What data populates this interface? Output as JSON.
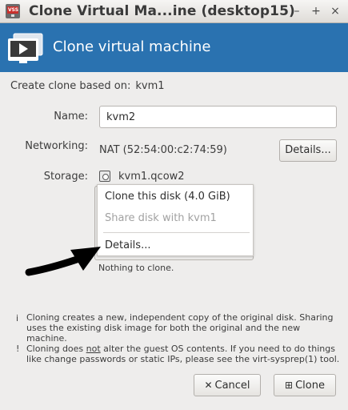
{
  "window": {
    "app_icon_label": "VSS",
    "title": "Clone Virtual Ma...ine (desktop15)",
    "minimize": "–",
    "maximize": "+",
    "close": "×"
  },
  "header": {
    "title": "Clone virtual machine"
  },
  "form": {
    "based_on_label": "Create clone based on:",
    "based_on_value": "kvm1",
    "name_label": "Name:",
    "name_value": "kvm2",
    "networking_label": "Networking:",
    "networking_value": "NAT (52:54:00:c2:74:59)",
    "networking_details_button": "Details...",
    "storage_label": "Storage:",
    "storage_value": "kvm1.qcow2"
  },
  "storage_menu": {
    "items": [
      {
        "label": "Clone this disk (4.0 GiB)",
        "enabled": true
      },
      {
        "label": "Share disk with kvm1",
        "enabled": false
      },
      {
        "label": "Details...",
        "enabled": true
      }
    ]
  },
  "status": {
    "nothing_to_clone": "Nothing to clone."
  },
  "notes": {
    "info_mark": "i",
    "info_text": "Cloning creates a new, independent copy of the original disk. Sharing uses the existing disk image for both the original and the new machine.",
    "warn_mark": "!",
    "warn_before": "Cloning does ",
    "warn_emph": "not",
    "warn_after": " alter the guest OS contents. If you need to do things like change passwords or static IPs, please see the virt-sysprep(1) tool."
  },
  "buttons": {
    "cancel": "Cancel",
    "cancel_icon": "✕",
    "clone": "Clone",
    "clone_icon": "⊞"
  },
  "colors": {
    "header_bg": "#2a72b0",
    "window_bg": "#eeedec"
  }
}
